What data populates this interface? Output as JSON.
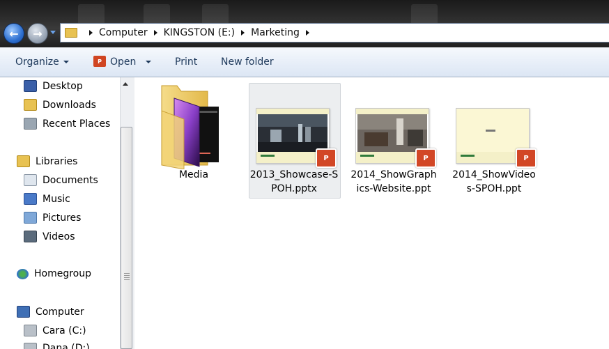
{
  "breadcrumb": [
    "Computer",
    "KINGSTON (E:)",
    "Marketing"
  ],
  "toolbar": {
    "organize": "Organize",
    "open": "Open",
    "print": "Print",
    "new_folder": "New folder"
  },
  "nav": {
    "favorites": [
      "Desktop",
      "Downloads",
      "Recent Places"
    ],
    "libraries": "Libraries",
    "library_items": [
      "Documents",
      "Music",
      "Pictures",
      "Videos"
    ],
    "homegroup": "Homegroup",
    "computer": "Computer",
    "drives": [
      "Cara (C:)",
      "Dana (D:)"
    ]
  },
  "files": [
    {
      "name_line1": "Media",
      "name_line2": "",
      "type": "folder"
    },
    {
      "name_line1": "2013_Showcase-S",
      "name_line2": "POH.pptx",
      "type": "pptx"
    },
    {
      "name_line1": "2014_ShowGraph",
      "name_line2": "ics-Website.ppt",
      "type": "ppt"
    },
    {
      "name_line1": "2014_ShowVideo",
      "name_line2": "s-SPOH.ppt",
      "type": "ppt"
    }
  ],
  "colors": {
    "ppt_orange": "#d24726",
    "folder_yellow": "#e8c252",
    "selection": "#eceef0"
  },
  "icons": [
    "back-arrow-icon",
    "forward-arrow-icon",
    "folder-icon",
    "powerpoint-icon"
  ]
}
